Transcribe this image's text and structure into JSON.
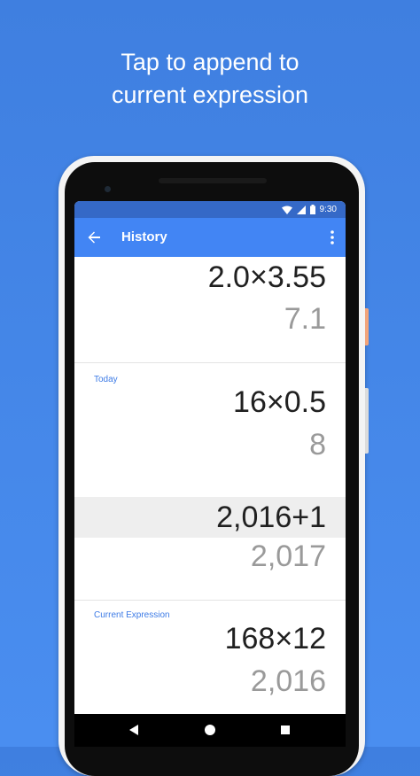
{
  "caption": {
    "line1": "Tap to append to",
    "line2": "current expression"
  },
  "status_bar": {
    "time": "9:30"
  },
  "app_bar": {
    "title": "History"
  },
  "history": [
    {
      "expression": "2.0×3.55",
      "result": "7.1"
    },
    {
      "section": "Today",
      "expression": "16×0.5",
      "result": "8"
    },
    {
      "expression": "2,016+1",
      "result": "2,017",
      "highlighted": true
    },
    {
      "section": "Current Expression",
      "expression": "168×12",
      "result": "2,016"
    }
  ],
  "nav_icons": [
    "back-triangle-icon",
    "home-circle-icon",
    "recents-square-icon"
  ],
  "colors": {
    "background": "#4a8ef0",
    "app_bar": "#4285f4",
    "status_bar": "#3569c7",
    "accent": "#3d7be6"
  }
}
